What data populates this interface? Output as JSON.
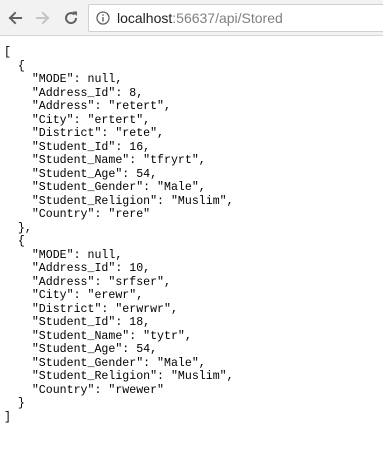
{
  "browser": {
    "url_host": "localhost",
    "url_rest": ":56637/api/Stored"
  },
  "json_text": "[\n  {\n    \"MODE\": null,\n    \"Address_Id\": 8,\n    \"Address\": \"retert\",\n    \"City\": \"ertert\",\n    \"District\": \"rete\",\n    \"Student_Id\": 16,\n    \"Student_Name\": \"tfryrt\",\n    \"Student_Age\": 54,\n    \"Student_Gender\": \"Male\",\n    \"Student_Religion\": \"Muslim\",\n    \"Country\": \"rere\"\n  },\n  {\n    \"MODE\": null,\n    \"Address_Id\": 10,\n    \"Address\": \"srfser\",\n    \"City\": \"erewr\",\n    \"District\": \"erwrwr\",\n    \"Student_Id\": 18,\n    \"Student_Name\": \"tytr\",\n    \"Student_Age\": 54,\n    \"Student_Gender\": \"Male\",\n    \"Student_Religion\": \"Muslim\",\n    \"Country\": \"rwewer\"\n  }\n]"
}
